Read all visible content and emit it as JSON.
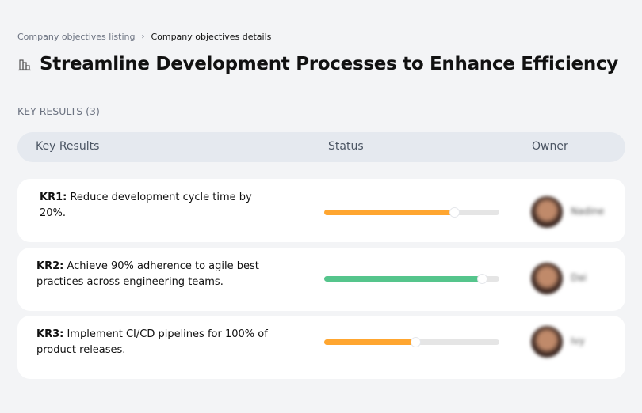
{
  "breadcrumb": {
    "parent": "Company objectives listing",
    "current": "Company objectives details"
  },
  "title": "Streamline Development Processes to Enhance Efficiency",
  "title_icon": "building-icon",
  "key_results_label": "KEY RESULTS (3)",
  "table": {
    "headers": [
      "Key Results",
      "Status",
      "Owner"
    ]
  },
  "colors": {
    "orange": "#ffa630",
    "green": "#55c58c",
    "track": "#e5e5e5"
  },
  "rows": [
    {
      "id": "KR1:",
      "text": " Reduce development cycle time by 20%.",
      "progress": 74,
      "color": "#ffa630",
      "owner": "Nadine"
    },
    {
      "id": "KR2:",
      "text": " Achieve 90% adherence to agile best practices across engineering teams.",
      "progress": 90,
      "color": "#55c58c",
      "owner": "Dai"
    },
    {
      "id": "KR3:",
      "text": " Implement CI/CD pipelines for 100% of product releases.",
      "progress": 52,
      "color": "#ffa630",
      "owner": "Ivy"
    }
  ]
}
